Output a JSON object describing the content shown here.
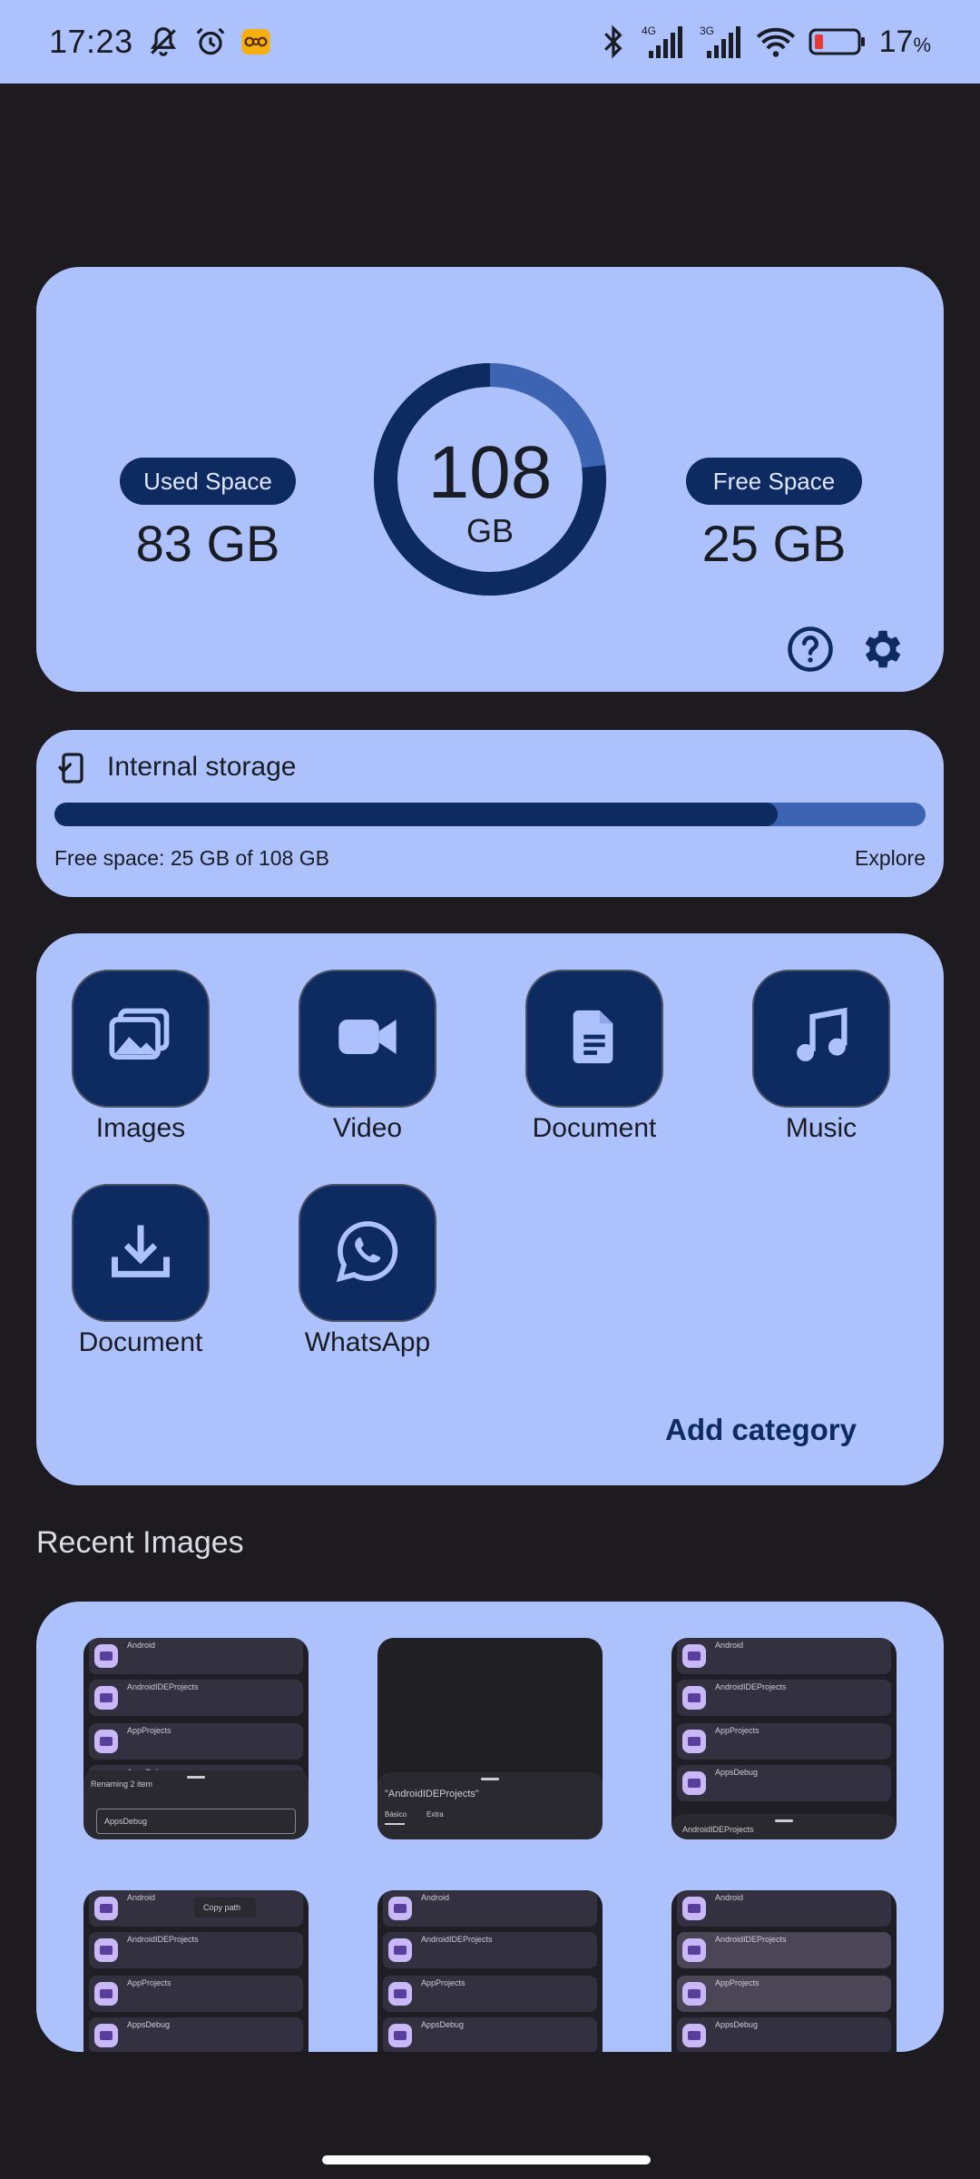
{
  "status_bar": {
    "time": "17:23",
    "battery_percent": "17",
    "battery_unit": "%",
    "network_1": "4G",
    "network_2": "3G",
    "icons": [
      "mute-bell-icon",
      "alarm-icon",
      "app-notification-icon",
      "bluetooth-icon",
      "signal-4g-icon",
      "signal-3g-icon",
      "wifi-icon",
      "battery-low-icon"
    ]
  },
  "storage": {
    "used_label": "Used Space",
    "used_value": "83 GB",
    "free_label": "Free Space",
    "free_value": "25 GB",
    "total_value": "108",
    "total_unit": "GB",
    "used_fraction": 0.77
  },
  "internal": {
    "title": "Internal storage",
    "free_text": "Free space: 25 GB of 108 GB",
    "explore_label": "Explore",
    "used_fraction": 0.83
  },
  "categories": [
    {
      "label": "Images",
      "icon": "images-icon"
    },
    {
      "label": "Video",
      "icon": "video-icon"
    },
    {
      "label": "Document",
      "icon": "document-icon"
    },
    {
      "label": "Music",
      "icon": "music-icon"
    },
    {
      "label": "Document",
      "icon": "download-icon"
    },
    {
      "label": "WhatsApp",
      "icon": "whatsapp-icon"
    }
  ],
  "add_category_label": "Add category",
  "recent_images_title": "Recent Images",
  "thumbnails": {
    "t1": {
      "items": [
        "Android",
        "AndroidIDEProjects",
        "AppProjects",
        "AppsDebug"
      ],
      "sheet_title": "Renaming 2 item",
      "sheet_input": "AppsDebug"
    },
    "t2": {
      "sheet_title": "\"AndroidIDEProjects\"",
      "tab1": "Básico",
      "tab2": "Extra"
    },
    "t3": {
      "items": [
        "Android",
        "AndroidIDEProjects",
        "AppProjects",
        "AppsDebug"
      ],
      "sheet_title": "AndroidIDEProjects"
    },
    "t4": {
      "items": [
        "Android",
        "AndroidIDEProjects",
        "AppProjects",
        "AppsDebug"
      ],
      "popup": "Copy path"
    },
    "t5": {
      "items": [
        "Android",
        "AndroidIDEProjects",
        "AppProjects",
        "AppsDebug"
      ]
    },
    "t6": {
      "items": [
        "Android",
        "AndroidIDEProjects",
        "AppProjects",
        "AppsDebug"
      ]
    }
  },
  "colors": {
    "primary": "#0d2a61",
    "card": "#adc2fd",
    "background": "#1d1b20",
    "accent": "#3d64b2"
  }
}
